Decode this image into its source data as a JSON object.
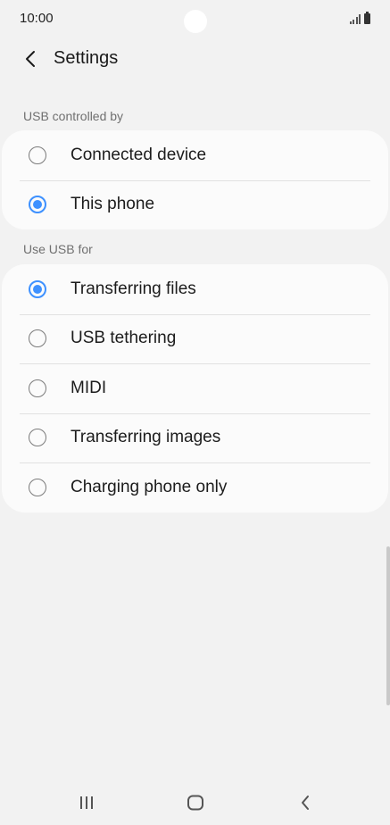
{
  "status_bar": {
    "time": "10:00"
  },
  "header": {
    "title": "Settings"
  },
  "sections": {
    "usb_controlled_by": {
      "label": "USB controlled by",
      "options": [
        {
          "label": "Connected device",
          "selected": false
        },
        {
          "label": "This phone",
          "selected": true
        }
      ]
    },
    "use_usb_for": {
      "label": "Use USB for",
      "options": [
        {
          "label": "Transferring files",
          "selected": true
        },
        {
          "label": "USB tethering",
          "selected": false
        },
        {
          "label": "MIDI",
          "selected": false
        },
        {
          "label": "Transferring images",
          "selected": false
        },
        {
          "label": "Charging phone only",
          "selected": false
        }
      ]
    }
  },
  "colors": {
    "accent": "#3e91ff",
    "background": "#f2f2f2",
    "card": "#fbfbfb"
  },
  "icons": {
    "back": "chevron-left-icon",
    "nav_recents": "recents-icon",
    "nav_home": "home-icon",
    "nav_back": "back-icon"
  }
}
